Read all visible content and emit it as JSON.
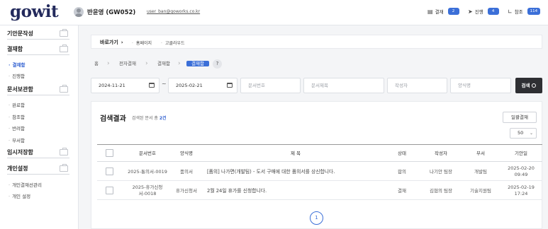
{
  "header": {
    "logo": "gowit",
    "user_name": "반윤영 (GW052)",
    "user_email": "user_ban@goworks.co.kr",
    "counters": [
      {
        "label": "결재",
        "count": "2",
        "icon": "approval-doc-icon"
      },
      {
        "label": "진행",
        "count": "4",
        "icon": "send-icon"
      },
      {
        "label": "참조",
        "count": "114",
        "icon": "share-icon"
      }
    ]
  },
  "sidebar": {
    "sections": [
      {
        "title": "기안문작성",
        "items": []
      },
      {
        "title": "결재함",
        "items": [
          {
            "label": "결재함",
            "active": true
          },
          {
            "label": "진행함"
          }
        ]
      },
      {
        "title": "문서보관함",
        "items": [
          {
            "label": "완료함"
          },
          {
            "label": "참조함"
          },
          {
            "label": "반려함"
          },
          {
            "label": "부서함"
          }
        ]
      },
      {
        "title": "임시저장함",
        "items": []
      },
      {
        "title": "개인설정",
        "items": [
          {
            "label": "개인결재선관리"
          },
          {
            "label": "개인 설정"
          }
        ]
      }
    ]
  },
  "quick": {
    "label": "바로가기",
    "links": [
      "홈페이지",
      "고클라우드"
    ]
  },
  "path": [
    "홈",
    "전자결재",
    "결재함",
    "결재함"
  ],
  "help": "?",
  "search": {
    "date_from": "2024-11-21",
    "date_to": "2025-02-21",
    "tilde": "~",
    "doc_no_placeholder": "문서번호",
    "doc_title_placeholder": "문서제목",
    "author_placeholder": "작성자",
    "form_placeholder": "양식명",
    "button": "검색"
  },
  "results": {
    "title": "검색결과",
    "count_prefix": "검색된 문서 총",
    "count": "2건",
    "bulk_button": "일괄결재",
    "page_size": "50",
    "columns": [
      "문서번호",
      "양식명",
      "제 목",
      "상태",
      "작성자",
      "부서",
      "기안일"
    ],
    "rows": [
      {
        "doc_no": "2025-통의서-0019",
        "form": "품의서",
        "subject": "[품의] 나가면(개발팀) - 도서 구매에 대한 품의서를 상신합니다.",
        "status": "합의",
        "author": "나기안 팀장",
        "dept": "개발팀",
        "date": "2025-02-20\n09:49"
      },
      {
        "doc_no": "2025-휴가신청서-0018",
        "form": "휴가신청서",
        "subject": "2월 24일 휴가를 신청합니다.",
        "status": "결재",
        "author": "김협의 팀장",
        "dept": "기술지원팀",
        "date": "2025-02-19\n17:24"
      }
    ],
    "page": "1"
  }
}
